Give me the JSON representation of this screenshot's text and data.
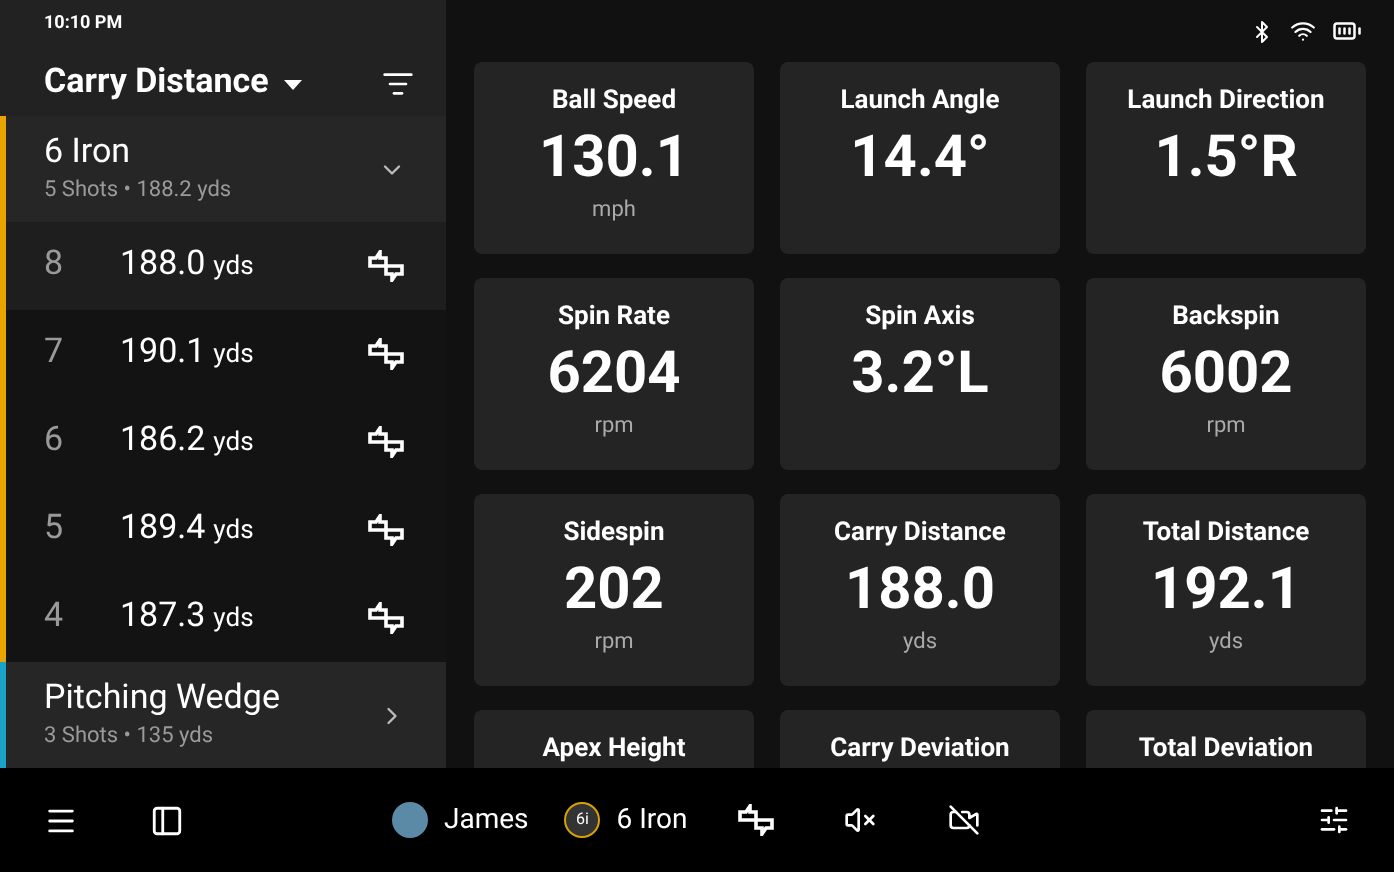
{
  "status_bar": {
    "time": "10:10 PM"
  },
  "sidebar": {
    "title": "Carry Distance",
    "groups": [
      {
        "name": "6 Iron",
        "summary": "5 Shots • 188.2 yds",
        "color": "#e8a400",
        "expanded": true,
        "shots": [
          {
            "number": "8",
            "value": "188.0",
            "unit": "yds",
            "selected": true
          },
          {
            "number": "7",
            "value": "190.1",
            "unit": "yds",
            "selected": false
          },
          {
            "number": "6",
            "value": "186.2",
            "unit": "yds",
            "selected": false
          },
          {
            "number": "5",
            "value": "189.4",
            "unit": "yds",
            "selected": false
          },
          {
            "number": "4",
            "value": "187.3",
            "unit": "yds",
            "selected": false
          }
        ]
      },
      {
        "name": "Pitching Wedge",
        "summary": "3 Shots • 135 yds",
        "color": "#1aa3c8",
        "expanded": false
      }
    ]
  },
  "metrics": [
    {
      "label": "Ball Speed",
      "value": "130.1",
      "unit": "mph"
    },
    {
      "label": "Launch Angle",
      "value": "14.4°"
    },
    {
      "label": "Launch Direction",
      "value": "1.5°R"
    },
    {
      "label": "Spin Rate",
      "value": "6204",
      "unit": "rpm"
    },
    {
      "label": "Spin Axis",
      "value": "3.2°L"
    },
    {
      "label": "Backspin",
      "value": "6002",
      "unit": "rpm"
    },
    {
      "label": "Sidespin",
      "value": "202",
      "unit": "rpm"
    },
    {
      "label": "Carry Distance",
      "value": "188.0",
      "unit": "yds"
    },
    {
      "label": "Total Distance",
      "value": "192.1",
      "unit": "yds"
    },
    {
      "label": "Apex Height"
    },
    {
      "label": "Carry Deviation"
    },
    {
      "label": "Total Deviation"
    }
  ],
  "bottom_bar": {
    "player": "James",
    "club_badge": "6i",
    "club": "6 Iron"
  }
}
